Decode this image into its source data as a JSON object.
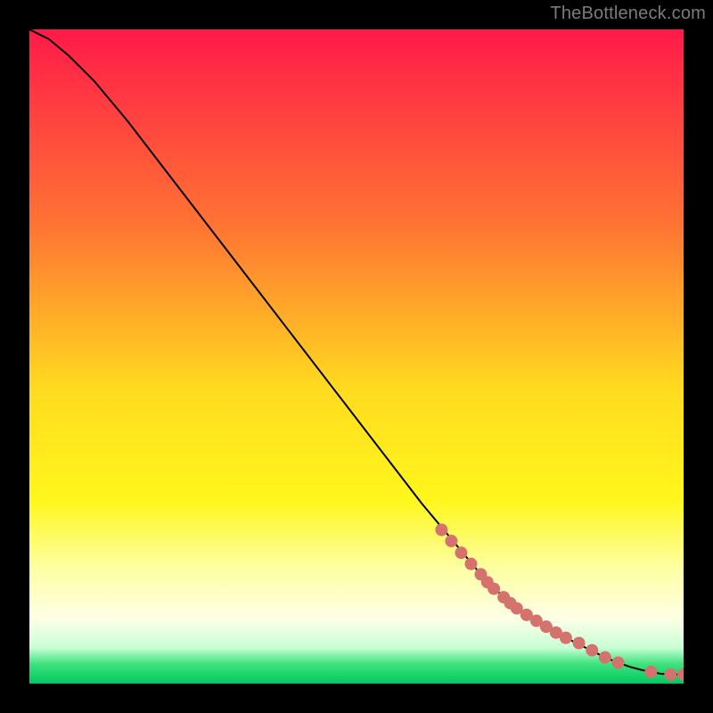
{
  "attribution": "TheBottleneck.com",
  "chart_data": {
    "type": "line",
    "title": "",
    "xlabel": "",
    "ylabel": "",
    "xlim": [
      0,
      100
    ],
    "ylim": [
      0,
      100
    ],
    "grid": false,
    "legend": false,
    "background_gradient": {
      "stops": [
        {
          "offset": 0.0,
          "color": "#ff1a49"
        },
        {
          "offset": 0.3,
          "color": "#ff7433"
        },
        {
          "offset": 0.55,
          "color": "#ffdb1f"
        },
        {
          "offset": 0.72,
          "color": "#fff71c"
        },
        {
          "offset": 0.82,
          "color": "#fdff9e"
        },
        {
          "offset": 0.9,
          "color": "#feffe6"
        },
        {
          "offset": 0.945,
          "color": "#c8ffd6"
        },
        {
          "offset": 0.97,
          "color": "#3ee27d"
        },
        {
          "offset": 1.0,
          "color": "#00c95f"
        }
      ]
    },
    "series": [
      {
        "name": "curve",
        "type": "line",
        "color": "#000000",
        "x": [
          0,
          3,
          6,
          10,
          15,
          20,
          30,
          40,
          50,
          60,
          70,
          75,
          80,
          85,
          88,
          90,
          92,
          93.5,
          95,
          96.5,
          98,
          100
        ],
        "y": [
          100,
          98.5,
          96,
          92,
          86,
          79.5,
          66.5,
          53.5,
          40.5,
          27.5,
          15.5,
          11,
          8,
          5.5,
          4,
          3.2,
          2.5,
          2.1,
          1.8,
          1.5,
          1.4,
          1.4
        ]
      },
      {
        "name": "markers",
        "type": "scatter",
        "color": "#d6726e",
        "x": [
          63,
          64.5,
          66,
          67.5,
          69,
          70,
          71,
          72.5,
          73.5,
          74.5,
          76,
          77.5,
          79,
          80.5,
          82,
          84,
          86,
          88,
          90,
          95,
          98,
          100
        ],
        "y": [
          23.5,
          21.8,
          20.0,
          18.3,
          16.7,
          15.5,
          14.5,
          13.2,
          12.3,
          11.5,
          10.5,
          9.6,
          8.7,
          7.8,
          7.0,
          6.2,
          5.1,
          4.0,
          3.2,
          1.8,
          1.4,
          1.4
        ]
      }
    ]
  }
}
